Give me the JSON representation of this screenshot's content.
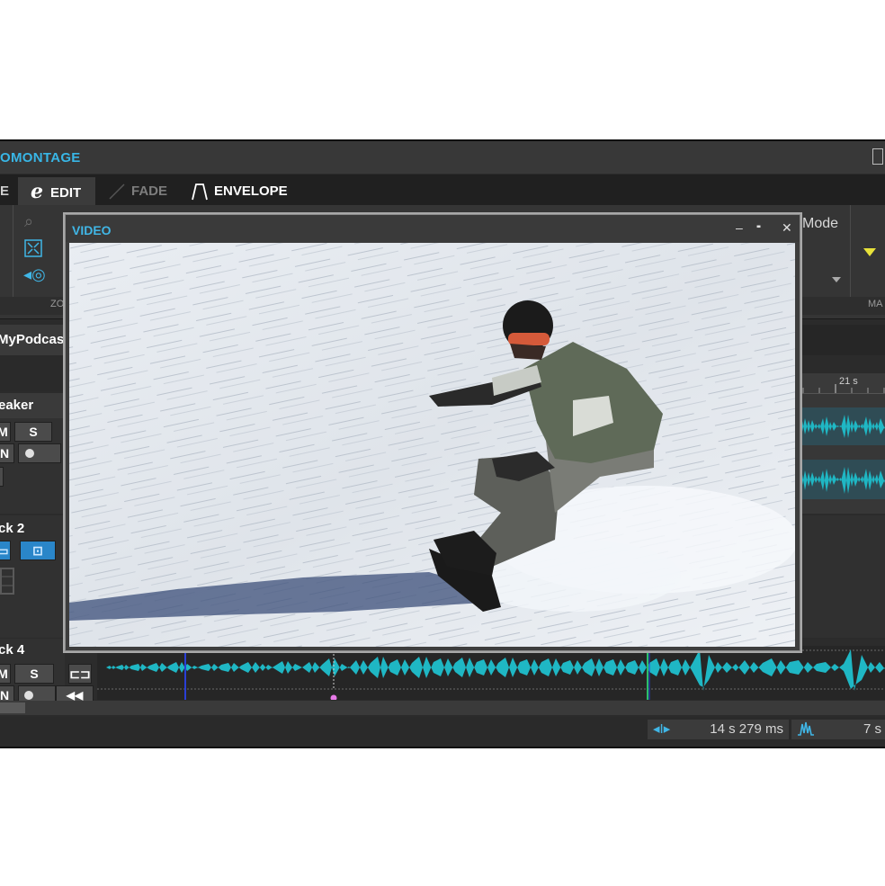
{
  "app": {
    "title": "OMONTAGE"
  },
  "tabs": [
    {
      "label": "E",
      "state": "partial"
    },
    {
      "label": "EDIT",
      "state": "active",
      "icon": "edit-e-icon"
    },
    {
      "label": "FADE",
      "state": "inactive",
      "icon": "fade-slope-icon"
    },
    {
      "label": "ENVELOPE",
      "state": "inactive",
      "icon": "envelope-curve-icon"
    }
  ],
  "ribbon": {
    "mode_label": "Mode",
    "zoom_group_label": "ZO",
    "marker_group_label": "MA",
    "icons": [
      "zoom-icon",
      "fit-icon",
      "zoom-in-icon"
    ]
  },
  "document": {
    "tab_label": "MyPodcast"
  },
  "tracks": [
    {
      "name": "eaker",
      "mute": "M",
      "solo": "S",
      "monitor": "N"
    },
    {
      "name": "ck 2"
    },
    {
      "name": "ck 4",
      "mute": "M",
      "solo": "S",
      "monitor": "N"
    }
  ],
  "ruler": {
    "label": "21 s"
  },
  "video_window": {
    "title": "VIDEO",
    "minimize": "–",
    "layout": "▪▪",
    "close": "✕"
  },
  "status": {
    "cursor_time": "14 s 279 ms",
    "second_time": "7 s"
  },
  "colors": {
    "accent": "#40b6e6",
    "waveform": "#1fb7c4",
    "marker_yellow": "#e8e23a",
    "background": "#2b2b2b"
  }
}
